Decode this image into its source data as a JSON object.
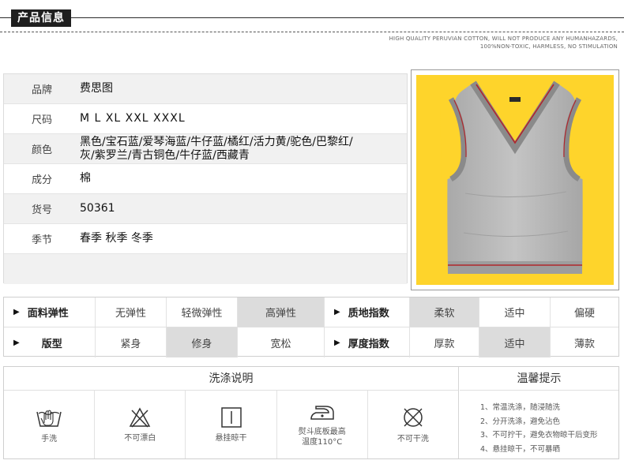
{
  "header": {
    "tag": "产品信息",
    "sub_line1": "HIGH QUALITY PERUVIAN COTTON, WILL NOT PRODUCE ANY HUMANHAZARDS,",
    "sub_line2": "100%NON-TOXIC, HARMLESS, NO STIMULATION"
  },
  "info": {
    "brand_label": "品牌",
    "brand": "费思图",
    "size_label": "尺码",
    "sizes": "M  L  XL  XXL  XXXL",
    "color_label": "颜色",
    "colors_line1": "黑色/宝石蓝/爱琴海蓝/牛仔蓝/橘红/活力黄/驼色/巴黎红/",
    "colors_line2": "灰/紫罗兰/青古铜色/牛仔蓝/西藏青",
    "material_label": "成分",
    "material": "棉",
    "item_label": "货号",
    "item_no": "50361",
    "season_label": "季节",
    "season": "春季  秋季  冬季"
  },
  "scale": {
    "elasticity_label": "面料弹性",
    "elasticity_opts": [
      "无弹性",
      "轻微弹性",
      "高弹性"
    ],
    "texture_label": "质地指数",
    "texture_opts": [
      "柔软",
      "适中",
      "偏硬"
    ],
    "fit_label": "版型",
    "fit_opts": [
      "紧身",
      "修身",
      "宽松"
    ],
    "thickness_label": "厚度指数",
    "thickness_opts": [
      "厚款",
      "适中",
      "薄款"
    ]
  },
  "care": {
    "title": "洗涤说明",
    "icons": [
      "手洗",
      "不可漂白",
      "悬挂晾干",
      "熨斗底板最高",
      "温度110°C",
      "不可干洗"
    ],
    "tips_title": "温馨提示",
    "tips": [
      "1、常温洗涤，随浸随洗",
      "2、分开洗涤，避免沾色",
      "3、不可拧干，避免衣物晾干后变形",
      "4、悬挂晾干，不可暴晒"
    ]
  },
  "colors": {
    "photo_bg": "#fed42b",
    "vest": "#b9b9b9",
    "trim": "#b0262d",
    "highlight": "#dcdcdc"
  }
}
